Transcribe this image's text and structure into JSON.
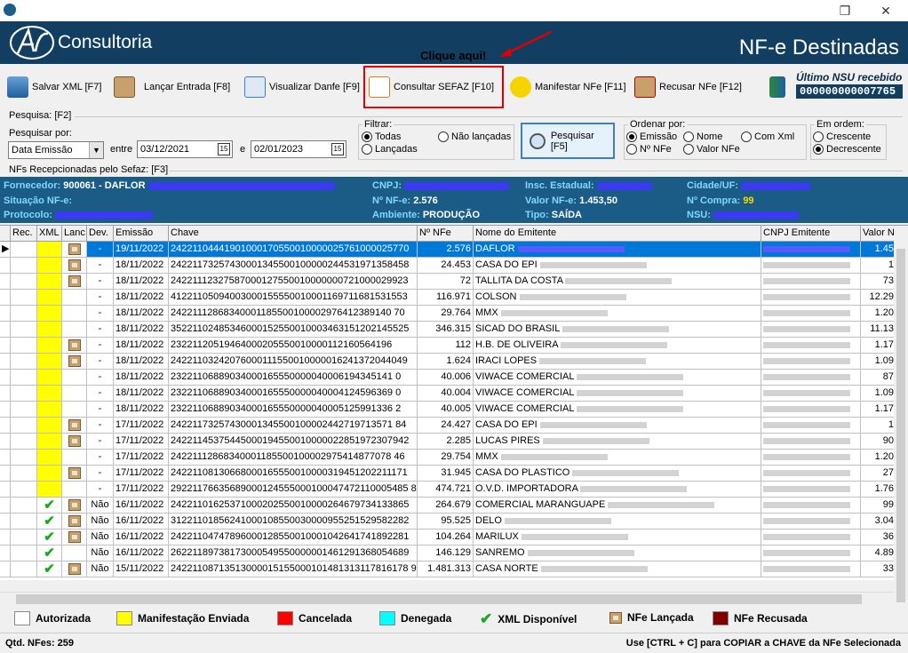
{
  "window": {
    "restore_glyph": "❐",
    "close_glyph": "✕"
  },
  "header": {
    "brand": "Consultoria",
    "page_title": "NF-e Destinadas"
  },
  "toolbar": {
    "salvar_xml": "Salvar XML [F7]",
    "lancar_entrada": "Lançar Entrada [F8]",
    "visualizar_danfe": "Visualizar Danfe [F9]",
    "consultar_sefaz": "Consultar SEFAZ [F10]",
    "manifestar_nfe": "Manifestar NFe [F11]",
    "recusar_nfe": "Recusar NFe [F12]",
    "hint": "Clique aqui!",
    "ultimo_nsu_label": "Último NSU recebido",
    "ultimo_nsu_value": "000000000007765"
  },
  "search": {
    "section": "Pesquisa: [F2]",
    "pesquisar_por_label": "Pesquisar por:",
    "pesquisar_por_value": "Data Emissão",
    "entre": "entre",
    "e": "e",
    "date_from": "03/12/2021",
    "date_to": "02/01/2023",
    "filtrar_label": "Filtrar:",
    "filtrar_opts": [
      "Todas",
      "Lançadas",
      "Não lançadas"
    ],
    "pesquisar_btn": "Pesquisar [F5]",
    "ordenar_label": "Ordenar por:",
    "ordenar_opts": [
      "Emissão",
      "Nº NFe",
      "Nome",
      "Valor NFe",
      "Com Xml"
    ],
    "ordem_label": "Em ordem:",
    "ordem_opts": [
      "Crescente",
      "Decrescente"
    ]
  },
  "section_nfs": "NFs Recepcionadas pelo Sefaz: [F3]",
  "info": {
    "fornecedor_k": "Fornecedor:",
    "fornecedor_v": "900061 - DAFLOR",
    "cnpj_k": "CNPJ:",
    "insc_k": "Insc. Estadual:",
    "cidade_k": "Cidade/UF:",
    "situacao_k": "Situação NF-e:",
    "nnfe_k": "Nº NF-e:",
    "nnfe_v": "2.576",
    "valor_k": "Valor NF-e:",
    "valor_v": "1.453,50",
    "compra_k": "Nº Compra:",
    "compra_v": "99",
    "protocolo_k": "Protocolo:",
    "ambiente_k": "Ambiente:",
    "ambiente_v": "PRODUÇÃO",
    "tipo_k": "Tipo:",
    "tipo_v": "SAÍDA",
    "nsu_k": "NSU:"
  },
  "grid": {
    "columns": [
      "Rec.",
      "XML",
      "Lanc.",
      "Dev.",
      "Emissão",
      "Chave",
      "Nº NFe",
      "Nome do Emitente",
      "CNPJ Emitente",
      "Valor N"
    ],
    "rows": [
      {
        "yel": true,
        "lanc": true,
        "xml": false,
        "dev": "-",
        "emissao": "19/11/2022",
        "chave": "24221104441901000170550010000025761000025770",
        "nnfe": "2.576",
        "nome": "DAFLOR",
        "valor": "1.45"
      },
      {
        "yel": true,
        "lanc": true,
        "xml": false,
        "dev": "-",
        "emissao": "18/11/2022",
        "chave": "24221173257430001345500100000244531971358458",
        "nnfe": "24.453",
        "nome": "CASA DO EPI",
        "valor": "1"
      },
      {
        "yel": true,
        "lanc": true,
        "xml": false,
        "dev": "-",
        "emissao": "18/11/2022",
        "chave": "24221112327587000127550010000000721000029923",
        "nnfe": "72",
        "nome": "TALLITA DA COSTA",
        "valor": "73"
      },
      {
        "yel": true,
        "lanc": false,
        "xml": false,
        "dev": "-",
        "emissao": "18/11/2022",
        "chave": "41221105094003000155550010001169711681531553",
        "nnfe": "116.971",
        "nome": "COLSON",
        "valor": "12.29"
      },
      {
        "yel": true,
        "lanc": false,
        "xml": false,
        "dev": "-",
        "emissao": "18/11/2022",
        "chave": "24221112868340001185500100002976412389140 70",
        "nnfe": "29.764",
        "nome": "MMX",
        "valor": "1.20"
      },
      {
        "yel": true,
        "lanc": false,
        "xml": false,
        "dev": "-",
        "emissao": "18/11/2022",
        "chave": "35221102485346000152550010003463151202145525",
        "nnfe": "346.315",
        "nome": "SICAD DO BRASIL",
        "valor": "11.13"
      },
      {
        "yel": true,
        "lanc": true,
        "xml": false,
        "dev": "-",
        "emissao": "18/11/2022",
        "chave": "23221120519464000205550010000112160564196",
        "nnfe": "112",
        "nome": "H.B. DE OLIVEIRA",
        "valor": "1.17"
      },
      {
        "yel": true,
        "lanc": true,
        "xml": false,
        "dev": "-",
        "emissao": "18/11/2022",
        "chave": "24221103242076000111550010000016241372044049",
        "nnfe": "1.624",
        "nome": "IRACI LOPES",
        "valor": "1.09"
      },
      {
        "yel": true,
        "lanc": false,
        "xml": false,
        "dev": "-",
        "emissao": "18/11/2022",
        "chave": "23221106889034000165550000040006194345141 0",
        "nnfe": "40.006",
        "nome": "VIWACE COMERCIAL",
        "valor": "87"
      },
      {
        "yel": true,
        "lanc": false,
        "xml": false,
        "dev": "-",
        "emissao": "18/11/2022",
        "chave": "23221106889034000165550000040004124596369 0",
        "nnfe": "40.004",
        "nome": "VIWACE COMERCIAL",
        "valor": "1.09"
      },
      {
        "yel": true,
        "lanc": false,
        "xml": false,
        "dev": "-",
        "emissao": "18/11/2022",
        "chave": "23221106889034000165550000040005125991336 2",
        "nnfe": "40.005",
        "nome": "VIWACE COMERCIAL",
        "valor": "1.17"
      },
      {
        "yel": true,
        "lanc": true,
        "xml": false,
        "dev": "-",
        "emissao": "17/11/2022",
        "chave": "24221173257430001345500100002442719713571 84",
        "nnfe": "24.427",
        "nome": "CASA DO EPI",
        "valor": "1"
      },
      {
        "yel": true,
        "lanc": true,
        "xml": false,
        "dev": "-",
        "emissao": "17/11/2022",
        "chave": "24221145375445000194550010000022851972307942",
        "nnfe": "2.285",
        "nome": "LUCAS PIRES",
        "valor": "90"
      },
      {
        "yel": true,
        "lanc": false,
        "xml": false,
        "dev": "-",
        "emissao": "17/11/2022",
        "chave": "24221112868340001185500100002975414877078 46",
        "nnfe": "29.754",
        "nome": "MMX",
        "valor": "1.20"
      },
      {
        "yel": true,
        "lanc": true,
        "xml": false,
        "dev": "-",
        "emissao": "17/11/2022",
        "chave": "24221108130668000165550010000319451202211171",
        "nnfe": "31.945",
        "nome": "CASA DO PLASTICO",
        "valor": "27"
      },
      {
        "yel": true,
        "lanc": false,
        "xml": false,
        "dev": "-",
        "emissao": "17/11/2022",
        "chave": "29221176635689000124555000100047472110005485 85",
        "nnfe": "474.721",
        "nome": "O.V.D. IMPORTADORA",
        "valor": "1.76"
      },
      {
        "yel": false,
        "lanc": true,
        "xml": true,
        "dev": "Não",
        "emissao": "16/11/2022",
        "chave": "24221101625371000202550010000264679734133865",
        "nnfe": "264.679",
        "nome": "COMERCIAL MARANGUAPE",
        "valor": "99"
      },
      {
        "yel": false,
        "lanc": true,
        "xml": true,
        "dev": "Não",
        "emissao": "16/11/2022",
        "chave": "31221101856241000108550030000955251529582282",
        "nnfe": "95.525",
        "nome": "DELO",
        "valor": "3.04"
      },
      {
        "yel": false,
        "lanc": true,
        "xml": true,
        "dev": "Não",
        "emissao": "16/11/2022",
        "chave": "24221104747896000128550010001042641741892281",
        "nnfe": "104.264",
        "nome": "MARILUX",
        "valor": "36"
      },
      {
        "yel": false,
        "lanc": false,
        "xml": true,
        "dev": "Não",
        "emissao": "16/11/2022",
        "chave": "26221189738173000549550000001461291368054689",
        "nnfe": "146.129",
        "nome": "SANREMO",
        "valor": "4.89"
      },
      {
        "yel": false,
        "lanc": true,
        "xml": true,
        "dev": "Não",
        "emissao": "15/11/2022",
        "chave": "24221108713513000015155000101481313117816178 9",
        "nnfe": "1.481.313",
        "nome": "CASA NORTE",
        "valor": "33"
      }
    ]
  },
  "legend": [
    {
      "label": "Autorizada",
      "color": "#ffffff"
    },
    {
      "label": "Manifestação Enviada",
      "color": "#ffff00"
    },
    {
      "label": "Cancelada",
      "color": "#ff0000"
    },
    {
      "label": "Denegada",
      "color": "#00ffff"
    },
    {
      "label": "XML Disponível",
      "icon": "check-icon"
    },
    {
      "label": "NFe Lançada",
      "icon": "box-icon"
    },
    {
      "label": "NFe Recusada",
      "color": "#800000"
    }
  ],
  "status": {
    "qtd": "Qtd. NFes: 259",
    "copy_hint": "Use [CTRL + C] para COPIAR a CHAVE da NFe Selecionada"
  }
}
